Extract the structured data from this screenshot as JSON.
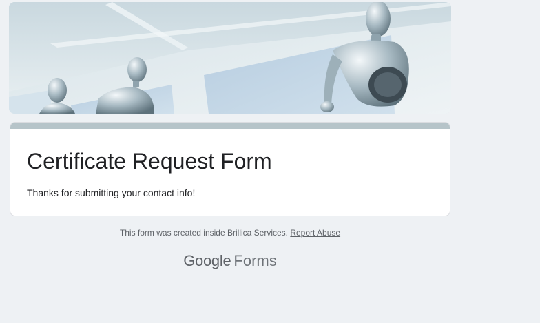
{
  "form": {
    "title": "Certificate Request Form",
    "confirmation_message": "Thanks for submitting your contact info!",
    "accent_color": "#b6c4c9"
  },
  "footer": {
    "note_text": "This form was created inside Brillica Services.",
    "report_abuse_link": "Report Abuse"
  },
  "branding": {
    "google_word": "Google",
    "forms_word": "Forms"
  },
  "banner": {
    "image_description_icon": "robots-office-banner-image"
  },
  "colors": {
    "background": "#eef1f4",
    "card": "#ffffff",
    "text": "#202124",
    "muted": "#5f6368"
  }
}
